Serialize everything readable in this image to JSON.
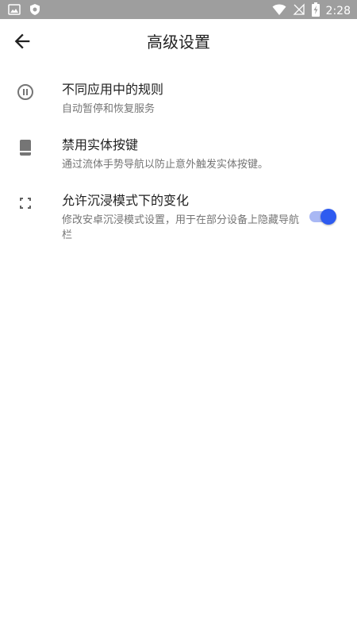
{
  "status_bar": {
    "time": "2:28",
    "left_icons": [
      "image-icon",
      "shield-icon"
    ],
    "right_icons": [
      "wifi-icon",
      "no-signal-icon",
      "battery-charging-icon"
    ],
    "background_color": "#9e9e9e"
  },
  "app_bar": {
    "title": "高级设置",
    "back_icon": "arrow-back-icon"
  },
  "settings": [
    {
      "icon": "pause-circle-icon",
      "title": "不同应用中的规则",
      "description": "自动暂停和恢复服务"
    },
    {
      "icon": "phone-icon",
      "title": "禁用实体按键",
      "description": "通过流体手势导航以防止意外触发实体按键。"
    },
    {
      "icon": "fullscreen-icon",
      "title": "允许沉浸模式下的变化",
      "description": "修改安卓沉浸模式设置，用于在部分设备上隐藏导航栏",
      "toggle_on": true
    }
  ],
  "colors": {
    "accent": "#2e5bf0",
    "accent_track": "#a9b8f4",
    "title_text": "#212121",
    "secondary_text": "#757575"
  }
}
